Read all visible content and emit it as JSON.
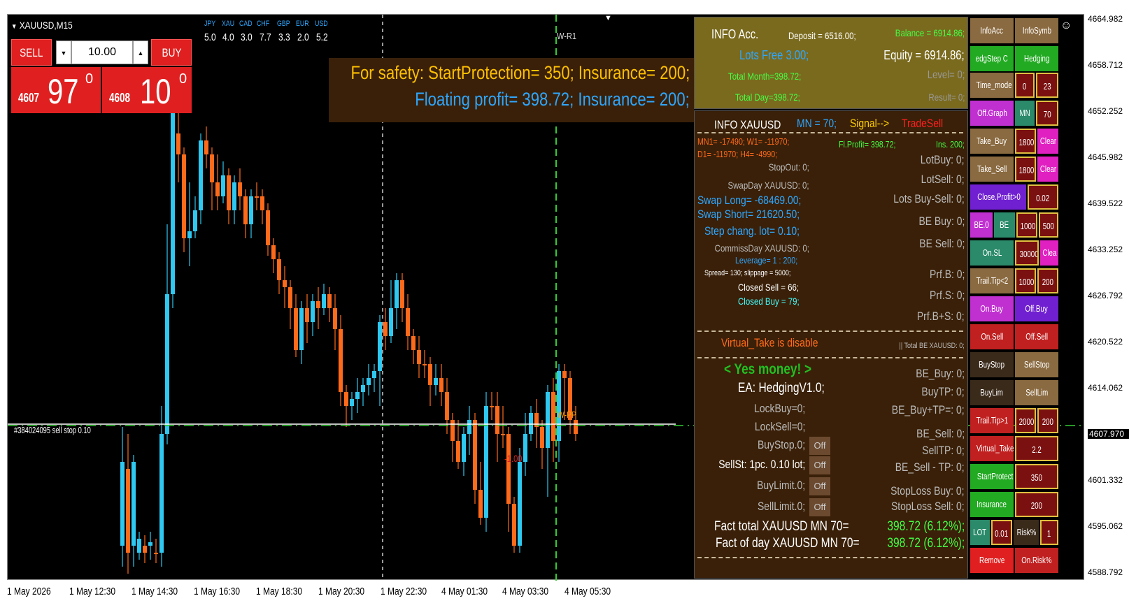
{
  "symbol": {
    "title": "XAUUSD,M15"
  },
  "trade": {
    "sell_label": "SELL",
    "buy_label": "BUY",
    "volume": "10.00",
    "sell_price_prefix": "4607",
    "sell_price_big": "97",
    "sell_price_sup": "0",
    "buy_price_prefix": "4608",
    "buy_price_big": "10",
    "buy_price_sup": "0"
  },
  "currencies": [
    {
      "code": "JPY",
      "value": "5.0"
    },
    {
      "code": "XAU",
      "value": "4.0"
    },
    {
      "code": "CAD",
      "value": "3.0"
    },
    {
      "code": "CHF",
      "value": "7.7"
    },
    {
      "code": "GBP",
      "value": "3.3"
    },
    {
      "code": "EUR",
      "value": "2.0"
    },
    {
      "code": "USD",
      "value": "5.2"
    }
  ],
  "safety": {
    "line1": "For safety: StartProtection= 350; Insurance= 200;",
    "line2": "Floating profit= 398.72; Insurance= 200;"
  },
  "chart": {
    "wr_label": "W-R1",
    "order_label": "#384024095 sell stop 0.10",
    "pp_label": "W-PP",
    "minus_label": "-1.00",
    "current_price": "4607.970",
    "colors": {
      "bull": "#2ec8f0",
      "bear": "#ff6a1a",
      "bg": "#000000",
      "grid_line": "#33cc33"
    }
  },
  "y_axis": [
    "4664.982",
    "4658.712",
    "4652.252",
    "4645.982",
    "4639.522",
    "4633.252",
    "4626.792",
    "4620.522",
    "4614.062",
    "4607.970",
    "4601.332",
    "4595.062",
    "4588.792"
  ],
  "x_axis": [
    "1 May 2026",
    "1 May 12:30",
    "1 May 14:30",
    "1 May 16:30",
    "1 May 18:30",
    "1 May 20:30",
    "1 May 22:30",
    "4 May 01:30",
    "4 May 03:30",
    "4 May 05:30"
  ],
  "info_acc": {
    "title": "INFO Acc.",
    "deposit": "Deposit = 6516.00;",
    "balance": "Balance = 6914.86;",
    "lots_free": "Lots Free 3.00;",
    "equity": "Equity = 6914.86;",
    "total_month": "Total Month=398.72;",
    "level": "Level= 0;",
    "total_day": "Total Day=398.72;",
    "result": "Result= 0;"
  },
  "info_symbol": {
    "title": "INFO XAUUSD",
    "mn": "MN = 70;",
    "signal": "Signal-->",
    "trade_sell": "TradeSell",
    "mn1_w1": "MN1= -17490;  W1= -11970;",
    "d1_h4": "D1= -11970;   H4= -4990;",
    "fl_profit": "Fl.Profit=  398.72;",
    "ins": "Ins. 200;",
    "stop_out": "StopOut: 0;",
    "swap_day": "SwapDay XAUUSD: 0;",
    "swap_long": "Swap Long= -68469.00;",
    "swap_short": "Swap Short= 21620.50;",
    "step_chang": "Step chang. lot= 0.10;",
    "commiss": "CommissDay XAUUSD: 0;",
    "leverage": "Leverage= 1 : 200;",
    "spread": "Spread= 130;  slippage = 5000;",
    "closed_sell": "Closed  Sell = 66;",
    "closed_buy": "Closed Buy = 79;",
    "lot_buy": "LotBuy: 0;",
    "lot_sell": "LotSell: 0;",
    "lots_buy_sell": "Lots Buy-Sell: 0;",
    "be_buy": "BE Buy: 0;",
    "be_sell": "BE Sell: 0;",
    "prf_b": "Prf.B: 0;",
    "prf_s": "Prf.S: 0;",
    "prf_bs": "Prf.B+S: 0;",
    "virtual_take": "Virtual_Take is disable",
    "total_be": "|| Total BE XAUUSD: 0;"
  },
  "ea": {
    "yes_money": "< Yes money! >",
    "name": "EA: HedgingV1.0;",
    "lock_buy": "LockBuy=0;",
    "lock_sell": "LockSell=0;",
    "buy_stop": "BuyStop.0;",
    "sell_st": "SellSt: 1pc. 0.10 lot;",
    "buy_limit": "BuyLimit.0;",
    "sell_limit": "SellLimit.0;",
    "off": "Off",
    "be_buy": "BE_Buy: 0;",
    "buy_tp": "BuyTP: 0;",
    "be_buy_tp": "BE_Buy+TP=: 0;",
    "be_sell": "BE_Sell: 0;",
    "sell_tp": "SellTP: 0;",
    "be_sell_tp": "BE_Sell - TP: 0;",
    "sl_buy": "StopLoss Buy: 0;",
    "sl_sell": "StopLoss Sell: 0;",
    "fact_total": "Fact total     XAUUSD MN 70=",
    "fact_day": "Fact of day XAUUSD MN 70=",
    "fact_total_val": "398.72 (6.12%);",
    "fact_day_val": "398.72 (6.12%);"
  },
  "buttons": {
    "info_acc": "InfoAcc",
    "info_symb": "InfoSymb",
    "hedg_step": "edgStep C",
    "hedging": "Hedging",
    "time_mode": "Time_mode",
    "time_a": "0",
    "time_b": "23",
    "off_graph": "Off.Graph",
    "mn": "MN",
    "mn_val": "70",
    "take_buy": "Take_Buy",
    "take_buy_val": "1800",
    "clear1": "Clear",
    "take_sell": "Take_Sell",
    "take_sell_val": "1800",
    "clear2": "Clear",
    "close_profit": "Close.Profit>0",
    "close_profit_val": "0.02",
    "be0": "BE.0",
    "be": "BE",
    "be_a": "1000",
    "be_b": "500",
    "on_sl": "On.SL",
    "on_sl_val": "30000",
    "clea": "Clea",
    "trail_tip2": "Trail.Tip<2",
    "trail_tip2_a": "1000",
    "trail_tip2_b": "200",
    "on_buy": "On.Buy",
    "off_buy": "Off.Buy",
    "on_sell": "On.Sell",
    "off_sell": "Off.Sell",
    "buy_stop": "BuyStop",
    "sell_stop": "SellStop",
    "buy_lim": "BuyLim",
    "sell_lim": "SellLim",
    "trail_tip1": "Trail.Tip>1",
    "trail_tip1_a": "2000",
    "trail_tip1_b": "200",
    "virtual_take": "Virtual_Take",
    "virtual_take_val": "2.2",
    "start_protection": "StartProtectio",
    "start_protection_val": "350",
    "insurance": "Insurance",
    "insurance_val": "200",
    "lot": "LOT",
    "lot_val": "0.01",
    "risk": "Risk%",
    "risk_val": "1",
    "remove": "Remove",
    "on_risk": "On.Risk%"
  }
}
